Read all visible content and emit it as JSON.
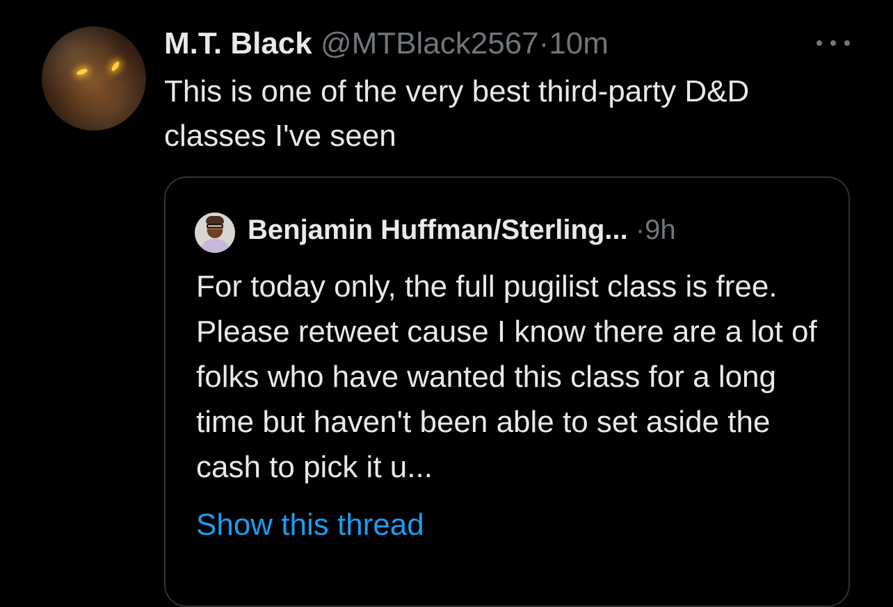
{
  "tweet": {
    "author_name": "M.T. Black",
    "handle": "@MTBlack2567",
    "separator": "·",
    "time": "10m",
    "more_icon": "more-horizontal-icon",
    "text": "This is one of the very best third-party D&D classes I've seen"
  },
  "quoted_tweet": {
    "author_name": "Benjamin Huffman/Sterling...",
    "separator": "·",
    "time": "9h",
    "text": "For today only, the full pugilist class is free. Please retweet cause I know there are a lot of folks who have wanted this class for a long time but haven't been able to set aside the cash to pick it u...",
    "show_thread_label": "Show this thread"
  },
  "colors": {
    "background": "#000000",
    "text": "#e7e9ea",
    "muted": "#71767b",
    "link": "#1d9bf0",
    "border": "#2f3336"
  }
}
